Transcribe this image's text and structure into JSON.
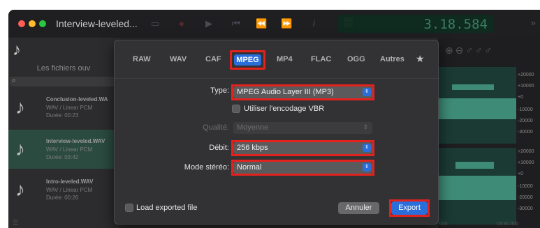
{
  "window": {
    "title": "Interview-leveled...",
    "timecode": "3.18.584"
  },
  "sidebar": {
    "header": "Les fichiers ouv",
    "items": [
      {
        "name": "Conclusion-leveled.WA",
        "format": "WAV / Linear PCM",
        "duration": "Durée: 00:23",
        "selected": false
      },
      {
        "name": "Interview-leveled.WAV",
        "format": "WAV / Linear PCM",
        "duration": "Durée: 03:42",
        "selected": true
      },
      {
        "name": "Intro-leveled.WAV",
        "format": "WAV / Linear PCM",
        "duration": "Durée: 00:26",
        "selected": false
      }
    ]
  },
  "waveform": {
    "scale_top": [
      "+20000",
      "+10000",
      "+0",
      "-10000",
      "-20000",
      "-30000"
    ],
    "scale_bottom": [
      "+20000",
      "+10000",
      "+0",
      "-10000",
      "-20000",
      "-30000"
    ],
    "time_labels": [
      "000",
      "03:30.000"
    ]
  },
  "dialog": {
    "tabs": [
      "RAW",
      "WAV",
      "CAF",
      "MPEG",
      "MP4",
      "FLAC",
      "OGG",
      "Autres"
    ],
    "active_tab": "MPEG",
    "type_label": "Type:",
    "type_value": "MPEG Audio Layer III (MP3)",
    "vbr_label": "Utiliser l'encodage VBR",
    "vbr_checked": false,
    "quality_label": "Qualité:",
    "quality_value": "Moyenne",
    "bitrate_label": "Débit:",
    "bitrate_value": "256 kbps",
    "stereo_label": "Mode stéréo:",
    "stereo_value": "Normal",
    "load_label": "Load exported file",
    "load_checked": false,
    "cancel_label": "Annuler",
    "export_label": "Export"
  },
  "colors": {
    "accent": "#2a6edc",
    "highlight": "#e3221d",
    "wave": "#3e8c78"
  }
}
